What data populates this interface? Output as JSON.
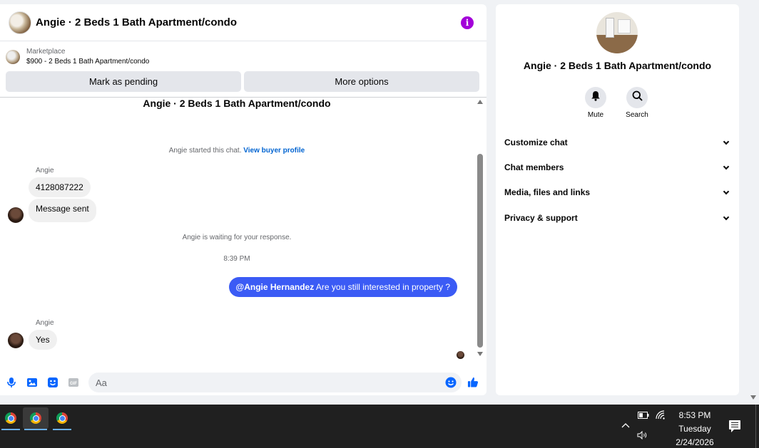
{
  "chat": {
    "title": "Angie · 2 Beds 1 Bath Apartment/condo",
    "info_icon": "info-icon",
    "marketplace_label": "Marketplace",
    "marketplace_listing": "$900 - 2 Beds 1 Bath Apartment/condo",
    "mark_pending_label": "Mark as pending",
    "more_options_label": "More options",
    "conversation_title": "Angie · 2 Beds 1 Bath Apartment/condo",
    "started_text": "Angie started this chat.",
    "view_buyer_label": "View buyer profile",
    "sender_1": "Angie",
    "msg_phone": "4128087222",
    "msg_sent": "Message sent",
    "waiting_text": "Angie is waiting for your response.",
    "timestamp": "8:39 PM",
    "out_mention": "@Angie Hernandez",
    "out_text": " Are you still interested in property ?",
    "sender_2": "Angie",
    "msg_yes": "Yes",
    "input_placeholder": "Aa"
  },
  "info": {
    "name": "Angie · 2 Beds 1 Bath Apartment/condo",
    "mute_label": "Mute",
    "search_label": "Search",
    "sections": [
      "Customize chat",
      "Chat members",
      "Media, files and links",
      "Privacy & support"
    ]
  },
  "taskbar": {
    "time": "8:53 PM",
    "day": "Tuesday",
    "date": "2/24/2026"
  },
  "colors": {
    "accent": "#3b5bf5",
    "link": "#0064d1",
    "info": "#a300d9",
    "taskbar": "#202020"
  }
}
